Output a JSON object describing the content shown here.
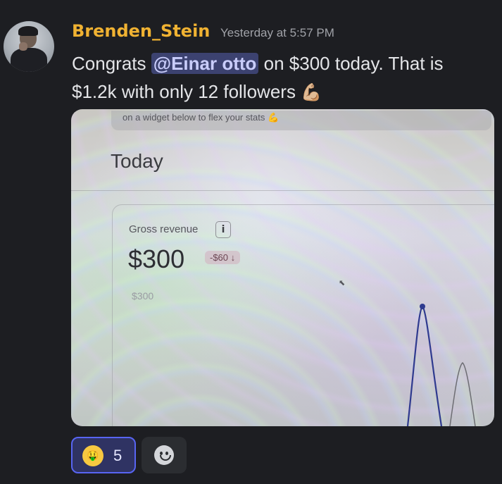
{
  "message": {
    "author": "Brenden_Stein",
    "timestamp": "Yesterday at 5:57 PM",
    "text_before_mention": "Congrats ",
    "mention": "@Einar otto",
    "text_after_mention": " on $300 today. That is",
    "text_line2": "$1.2k with only 12 followers ",
    "inline_emoji": "💪🏼"
  },
  "attachment": {
    "banner_text": "on a widget below to flex your stats 💪",
    "section_title": "Today",
    "metric_label": "Gross revenue",
    "info_icon_label": "i",
    "metric_value": "$300",
    "metric_delta": "-$60 ↓",
    "chart_y_label": "$300",
    "cursor_glyph": "⬉"
  },
  "reactions": [
    {
      "emoji": "🤑",
      "count": "5"
    }
  ],
  "colors": {
    "username": "#f0b232",
    "mention_bg": "#3c4270",
    "reaction_border": "#5865f2",
    "line_primary": "#2f3a8f",
    "line_secondary": "#6d6d73"
  }
}
